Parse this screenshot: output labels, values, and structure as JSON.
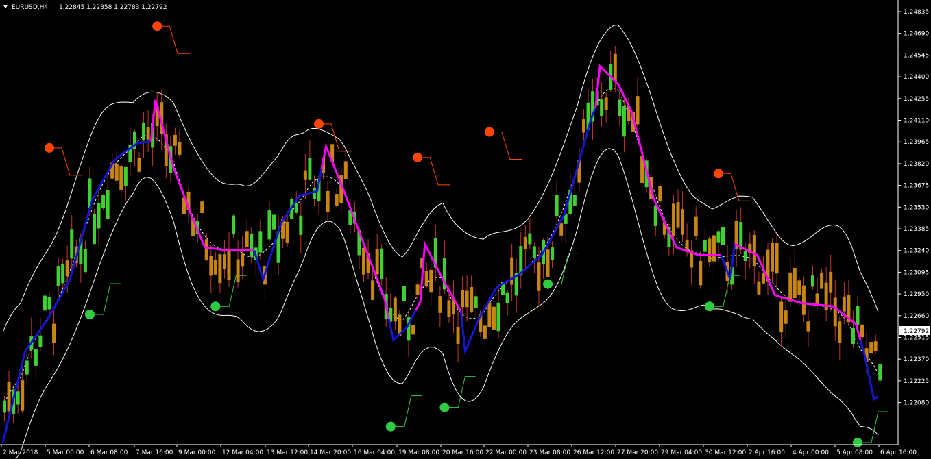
{
  "header": {
    "symbol": "EURUSD,H4",
    "ohlc": "1.22845 1.22858 1.22783 1.22792"
  },
  "current_price_label": "1.22792",
  "colors": {
    "background": "#000000",
    "bull_candle": "#3ed12f",
    "bear_candle": "#c8850f",
    "wick": "#c0392b",
    "envelope": "#ffffff",
    "midline": "#ffffff",
    "trend_up": "#1515d8",
    "trend_down": "#ff00ff",
    "signal_sell": "#ff4500",
    "signal_buy": "#2ecc40",
    "stop_sell": "#ff4500",
    "stop_buy": "#2ecc40"
  },
  "chart_data": {
    "type": "candlestick",
    "y_ticks": [
      "1.24835",
      "1.24690",
      "1.24545",
      "1.24400",
      "1.24255",
      "1.24110",
      "1.23965",
      "1.23820",
      "1.23675",
      "1.23530",
      "1.23385",
      "1.23240",
      "1.23095",
      "1.22950",
      "1.22660",
      "1.22515",
      "1.22370",
      "1.22225",
      "1.22080"
    ],
    "ylim": [
      1.2208,
      1.24835
    ],
    "x_ticks": [
      "2 Mar 2018",
      "5 Mar 00:00",
      "6 Mar 08:00",
      "7 Mar 16:00",
      "9 Mar 00:00",
      "12 Mar 04:00",
      "13 Mar 12:00",
      "14 Mar 20:00",
      "16 Mar 04:00",
      "19 Mar 08:00",
      "20 Mar 16:00",
      "22 Mar 00:00",
      "23 Mar 08:00",
      "26 Mar 12:00",
      "27 Mar 20:00",
      "29 Mar 04:00",
      "30 Mar 12:00",
      "2 Apr 16:00",
      "4 Apr 00:00",
      "5 Apr 08:00",
      "6 Apr 16:00"
    ],
    "trend_key": [
      [
        0,
        1.2208
      ],
      [
        5,
        1.2265
      ],
      [
        10,
        1.2285
      ],
      [
        15,
        1.231
      ],
      [
        20,
        1.236
      ],
      [
        25,
        1.2385
      ],
      [
        30,
        1.2395
      ],
      [
        33,
        1.2396
      ],
      [
        34,
        1.2422
      ],
      [
        38,
        1.238
      ],
      [
        42,
        1.235
      ],
      [
        45,
        1.233
      ],
      [
        50,
        1.2328
      ],
      [
        56,
        1.2328
      ],
      [
        58,
        1.231
      ],
      [
        62,
        1.2345
      ],
      [
        66,
        1.2362
      ],
      [
        70,
        1.2365
      ],
      [
        72,
        1.2393
      ],
      [
        76,
        1.2365
      ],
      [
        80,
        1.2335
      ],
      [
        85,
        1.2298
      ],
      [
        87,
        1.2272
      ],
      [
        90,
        1.228
      ],
      [
        93,
        1.2296
      ],
      [
        94,
        1.2332
      ],
      [
        98,
        1.231
      ],
      [
        102,
        1.229
      ],
      [
        103,
        1.2265
      ],
      [
        106,
        1.2285
      ],
      [
        110,
        1.2305
      ],
      [
        115,
        1.2313
      ],
      [
        120,
        1.2325
      ],
      [
        125,
        1.235
      ],
      [
        128,
        1.238
      ],
      [
        131,
        1.241
      ],
      [
        132,
        1.2417
      ],
      [
        133,
        1.2443
      ],
      [
        137,
        1.2432
      ],
      [
        140,
        1.2415
      ],
      [
        145,
        1.236
      ],
      [
        150,
        1.233
      ],
      [
        155,
        1.2325
      ],
      [
        160,
        1.2325
      ],
      [
        162,
        1.231
      ],
      [
        163,
        1.2332
      ],
      [
        168,
        1.2325
      ],
      [
        172,
        1.23
      ],
      [
        178,
        1.2295
      ],
      [
        185,
        1.2293
      ],
      [
        190,
        1.2282
      ],
      [
        192,
        1.2262
      ],
      [
        194,
        1.2235
      ],
      [
        195,
        1.2237
      ]
    ],
    "trend_breaks": [
      [
        0,
        33,
        "up"
      ],
      [
        33,
        56,
        "down"
      ],
      [
        56,
        71,
        "up"
      ],
      [
        71,
        86,
        "down"
      ],
      [
        86,
        92,
        "up"
      ],
      [
        92,
        102,
        "down"
      ],
      [
        102,
        132,
        "up"
      ],
      [
        132,
        160,
        "down"
      ],
      [
        160,
        163,
        "up"
      ],
      [
        163,
        191,
        "down"
      ],
      [
        191,
        195,
        "up"
      ]
    ],
    "signals_sell": [
      [
        10,
        1.2392
      ],
      [
        34,
        1.2468
      ],
      [
        70,
        1.2407
      ],
      [
        92,
        1.2386
      ],
      [
        108,
        1.2402
      ],
      [
        159,
        1.2376
      ]
    ],
    "signals_buy": [
      [
        19,
        1.2288
      ],
      [
        47,
        1.2293
      ],
      [
        86,
        1.2218
      ],
      [
        98,
        1.223
      ],
      [
        121,
        1.2307
      ],
      [
        157,
        1.2293
      ],
      [
        190,
        1.2208
      ]
    ]
  }
}
